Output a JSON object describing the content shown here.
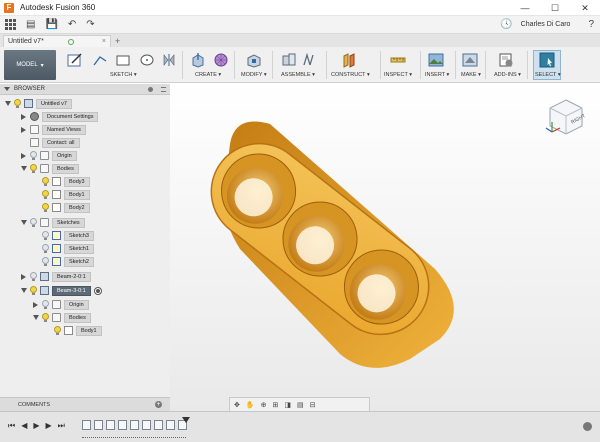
{
  "titlebar": {
    "title": "Autodesk Fusion 360",
    "app_icon_glyph": "F",
    "minimize_glyph": "—",
    "maximize_glyph": "☐",
    "close_glyph": "✕"
  },
  "qat": {
    "file_glyph": "▤",
    "save_glyph": "💾",
    "undo_glyph": "↶",
    "redo_glyph": "↷",
    "clock_glyph": "🕓",
    "user_name": "Charles Di Caro",
    "help_glyph": "?"
  },
  "tabs": {
    "document_tab": "Untitled v7*",
    "close_glyph": "×",
    "plus_glyph": "+"
  },
  "toolbar": {
    "workspace": "MODEL",
    "groups": {
      "sketch": "SKETCH",
      "create": "CREATE",
      "modify": "MODIFY",
      "assemble": "ASSEMBLE",
      "construct": "CONSTRUCT",
      "inspect": "INSPECT",
      "insert": "INSERT",
      "make": "MAKE",
      "addins": "ADD-INS",
      "select": "SELECT"
    },
    "colors": {
      "workspace_bg": "#5b6874",
      "select_active": "#2f7fa0"
    }
  },
  "browser": {
    "header": "BROWSER",
    "nodes": [
      {
        "label": "Untitled v7"
      },
      {
        "label": "Document Settings"
      },
      {
        "label": "Named Views"
      },
      {
        "label": "Contact: all"
      },
      {
        "label": "Origin"
      },
      {
        "label": "Bodies"
      },
      {
        "label": "Body3"
      },
      {
        "label": "Body1"
      },
      {
        "label": "Body2"
      },
      {
        "label": "Sketches"
      },
      {
        "label": "Sketch3"
      },
      {
        "label": "Sketch1"
      },
      {
        "label": "Sketch2"
      },
      {
        "label": "Beam-2-0:1"
      },
      {
        "label": "Beam-3-0:1"
      },
      {
        "label": "Origin"
      },
      {
        "label": "Bodies"
      },
      {
        "label": "Body1"
      }
    ]
  },
  "comments": {
    "label": "COMMENTS",
    "plus_glyph": "+"
  },
  "viewport": {
    "part_color": "#e8a52c",
    "viewcube_face": "RIGHT",
    "holes": 3
  },
  "navbar": {
    "items": [
      "✥",
      "✋",
      "⊕",
      "⊞",
      "◨",
      "▤",
      "⊟"
    ]
  },
  "timeline": {
    "controls": [
      "⏮",
      "◀",
      "▶",
      "▶",
      "⏭"
    ]
  }
}
